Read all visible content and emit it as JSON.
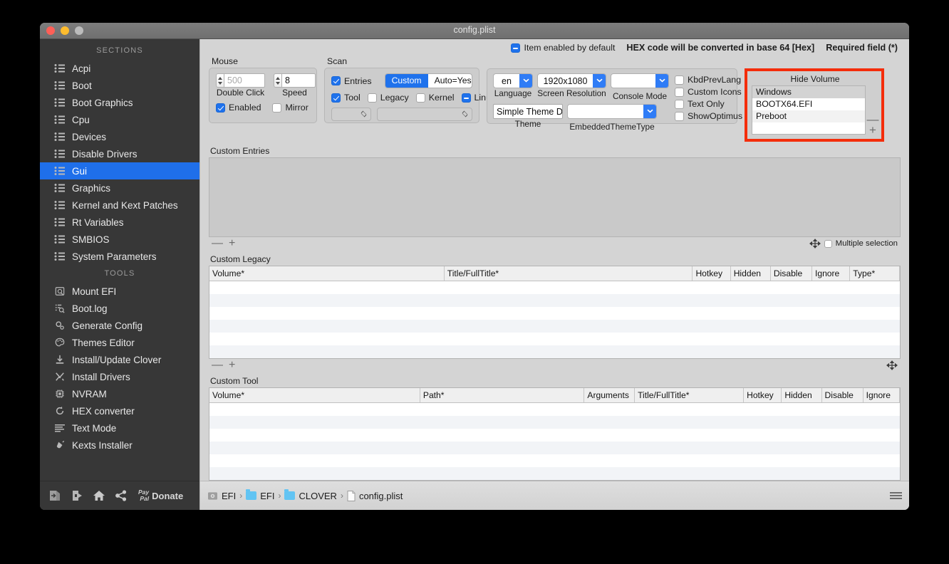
{
  "window": {
    "title": "config.plist"
  },
  "sidebar": {
    "sections_header": "SECTIONS",
    "sections": [
      {
        "label": "Acpi",
        "icon": "list-icon",
        "selected": false
      },
      {
        "label": "Boot",
        "icon": "list-icon",
        "selected": false
      },
      {
        "label": "Boot Graphics",
        "icon": "list-icon",
        "selected": false
      },
      {
        "label": "Cpu",
        "icon": "list-icon",
        "selected": false
      },
      {
        "label": "Devices",
        "icon": "list-icon",
        "selected": false
      },
      {
        "label": "Disable Drivers",
        "icon": "list-icon",
        "selected": false
      },
      {
        "label": "Gui",
        "icon": "list-icon",
        "selected": true
      },
      {
        "label": "Graphics",
        "icon": "list-icon",
        "selected": false
      },
      {
        "label": "Kernel and Kext Patches",
        "icon": "list-icon",
        "selected": false
      },
      {
        "label": "Rt Variables",
        "icon": "list-icon",
        "selected": false
      },
      {
        "label": "SMBIOS",
        "icon": "list-icon",
        "selected": false
      },
      {
        "label": "System Parameters",
        "icon": "list-icon",
        "selected": false
      }
    ],
    "tools_header": "TOOLS",
    "tools": [
      {
        "label": "Mount EFI",
        "icon": "disk-icon"
      },
      {
        "label": "Boot.log",
        "icon": "log-search-icon"
      },
      {
        "label": "Generate Config",
        "icon": "gears-icon"
      },
      {
        "label": "Themes Editor",
        "icon": "palette-icon"
      },
      {
        "label": "Install/Update Clover",
        "icon": "download-icon"
      },
      {
        "label": "Install Drivers",
        "icon": "tools-icon"
      },
      {
        "label": "NVRAM",
        "icon": "chip-icon"
      },
      {
        "label": "HEX converter",
        "icon": "refresh-icon"
      },
      {
        "label": "Text Mode",
        "icon": "text-lines-icon"
      },
      {
        "label": "Kexts Installer",
        "icon": "plug-icon"
      }
    ],
    "footer": {
      "import_label": "import-icon",
      "export_label": "export-icon",
      "home_label": "home-icon",
      "share_label": "share-icon",
      "paypal_line1": "Pay",
      "paypal_line2": "Pal",
      "donate_label": "Donate"
    }
  },
  "topnotes": {
    "item_enabled_label": "Item enabled by default",
    "item_enabled_state": "mixed",
    "hex_note": "HEX code will be converted in base 64 [Hex]",
    "required_note": "Required field (*)"
  },
  "mouse": {
    "group_label": "Mouse",
    "double_click_value": "500",
    "double_click_is_placeholder": true,
    "double_click_label": "Double Click",
    "speed_value": "8",
    "speed_label": "Speed",
    "enabled_label": "Enabled",
    "enabled_state": "on",
    "mirror_label": "Mirror",
    "mirror_state": "off"
  },
  "scan": {
    "group_label": "Scan",
    "entries_label": "Entries",
    "entries_state": "on",
    "segment_custom": "Custom",
    "segment_auto": "Auto=Yes",
    "segment_selected": "Custom",
    "tool_label": "Tool",
    "tool_state": "on",
    "legacy_label": "Legacy",
    "legacy_state": "off",
    "kernel_label": "Kernel",
    "kernel_state": "off",
    "linux_label": "Linux",
    "linux_state": "mixed",
    "combo_left_value": "",
    "combo_right_value": ""
  },
  "gui": {
    "language_value": "en",
    "language_label": "Language",
    "screen_resolution_value": "1920x1080",
    "screen_resolution_label": "Screen Resolution",
    "console_mode_value": "",
    "console_mode_label": "Console Mode",
    "theme_value": "Simple Theme Da",
    "theme_label": "Theme",
    "embedded_theme_value": "",
    "embedded_theme_label": "EmbeddedThemeType",
    "checks": [
      {
        "label": "KbdPrevLang",
        "state": "off"
      },
      {
        "label": "Custom Icons",
        "state": "off"
      },
      {
        "label": "Text Only",
        "state": "off"
      },
      {
        "label": "ShowOptimus",
        "state": "off"
      }
    ]
  },
  "hide_volume": {
    "title": "Hide Volume",
    "highlight_color": "#f42d0b",
    "items": [
      "Windows",
      "BOOTX64.EFI",
      "Preboot",
      ""
    ],
    "remove_label": "—",
    "add_label": "+"
  },
  "custom_entries": {
    "label": "Custom Entries",
    "remove_label": "—",
    "add_label": "+",
    "resize_icon": "move-handle-icon",
    "multiple_selection_label": "Multiple selection",
    "multiple_selection_state": "off"
  },
  "custom_legacy": {
    "label": "Custom Legacy",
    "columns": [
      "Volume*",
      "Title/FullTitle*",
      "Hotkey",
      "Hidden",
      "Disable",
      "Ignore",
      "Type*"
    ],
    "rows": [
      [],
      [],
      [],
      [],
      [],
      []
    ],
    "remove_label": "—",
    "add_label": "+",
    "resize_icon": "move-handle-icon"
  },
  "custom_tool": {
    "label": "Custom Tool",
    "columns": [
      "Volume*",
      "Path*",
      "Arguments",
      "Title/FullTitle*",
      "Hotkey",
      "Hidden",
      "Disable",
      "Ignore"
    ],
    "rows": [
      [],
      [],
      [],
      [],
      [],
      []
    ],
    "remove_label": "—",
    "add_label": "+",
    "resize_icon": "move-handle-icon"
  },
  "breadcrumb": {
    "items": [
      {
        "label": "EFI",
        "icon": "disk-icon"
      },
      {
        "label": "EFI",
        "icon": "folder-icon"
      },
      {
        "label": "CLOVER",
        "icon": "folder-icon"
      },
      {
        "label": "config.plist",
        "icon": "file-icon"
      }
    ],
    "separator": "›",
    "menu_icon": "hamburger-icon"
  }
}
